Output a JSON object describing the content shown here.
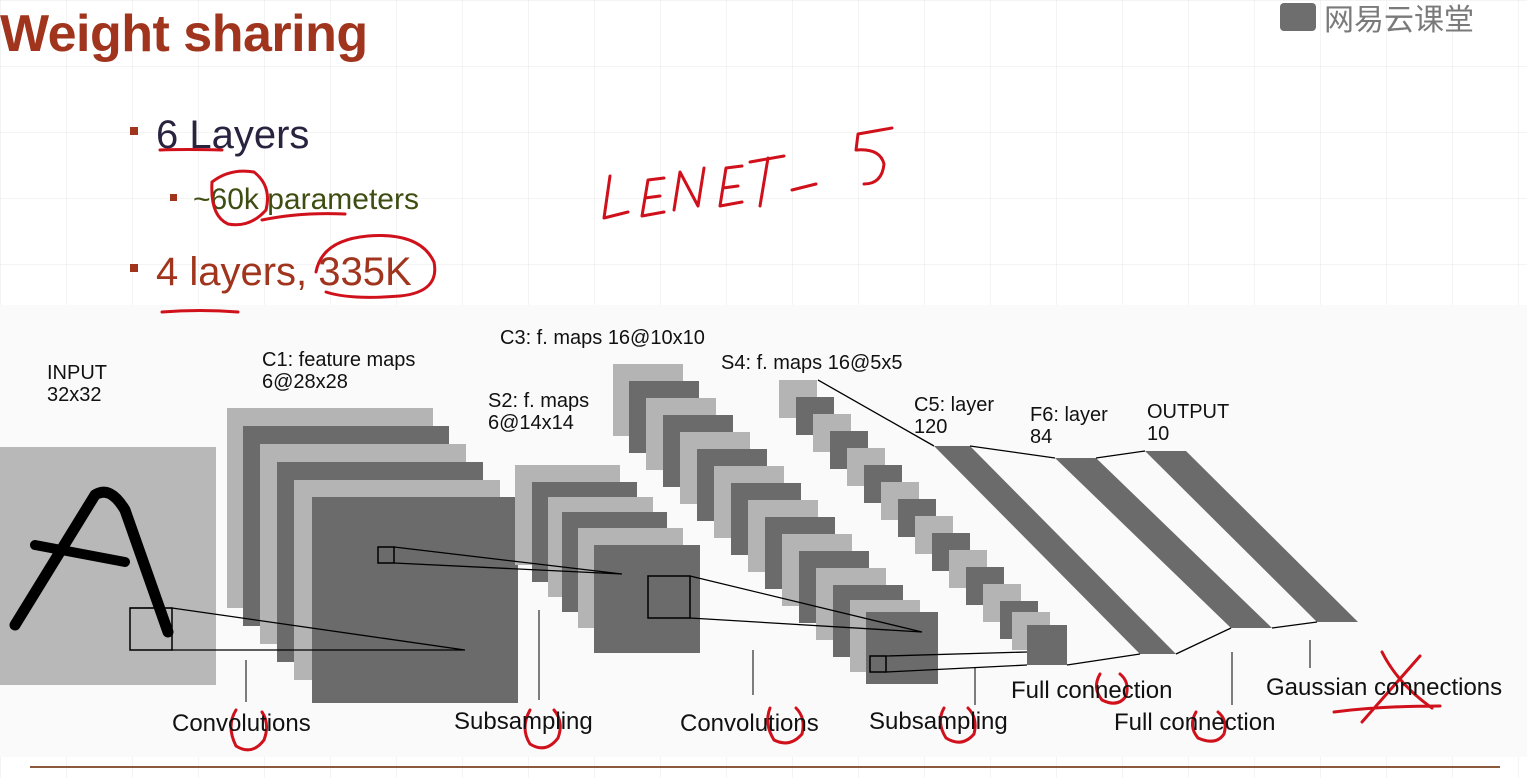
{
  "slide": {
    "title": "Weight sharing",
    "bullets": [
      {
        "text": "6 Layers",
        "level": 1
      },
      {
        "text": "~60k parameters",
        "level": 2
      },
      {
        "text": "4 layers, 335K",
        "level": 1
      }
    ],
    "handwritten_note": "LENET-5"
  },
  "watermark": {
    "text": "网易云课堂",
    "icon": "chat-bubble-icon"
  },
  "diagram": {
    "layer_labels": {
      "input": [
        "INPUT",
        "32x32"
      ],
      "c1": [
        "C1: feature maps",
        "6@28x28"
      ],
      "s2": [
        "S2: f. maps",
        "6@14x14"
      ],
      "c3": [
        "C3: f. maps 16@10x10"
      ],
      "s4": [
        "S4: f. maps 16@5x5"
      ],
      "c5": [
        "C5: layer",
        "120"
      ],
      "f6": [
        "F6: layer",
        "84"
      ],
      "output": [
        "OUTPUT",
        "10"
      ]
    },
    "operations": [
      "Convolutions",
      "Subsampling",
      "Convolutions",
      "Subsampling",
      "Full connection",
      "Full connection",
      "Gaussian connections"
    ]
  },
  "colors": {
    "title": "#a0341d",
    "ink_red": "#d0101a",
    "map_dark": "#6b6b6b",
    "map_light": "#b4b4b4"
  }
}
